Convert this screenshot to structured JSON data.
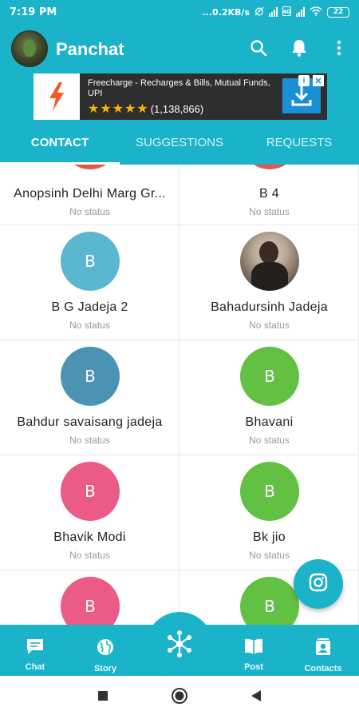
{
  "status_bar": {
    "time": "7:19 PM",
    "network_speed": "...0.2KB/s",
    "battery": "22"
  },
  "header": {
    "app_title": "Panchat",
    "icons": [
      "avatar",
      "search-icon",
      "bell-icon",
      "more-vert-icon"
    ]
  },
  "ad": {
    "title": "Freecharge - Recharges & Bills, Mutual Funds, UPI",
    "stars": "★★★★★",
    "rating_count": "(1,138,866)",
    "info_label": "i",
    "close_label": "✕"
  },
  "tabs": [
    {
      "label": "CONTACT",
      "active": true
    },
    {
      "label": "SUGGESTIONS",
      "active": false
    },
    {
      "label": "REQUESTS",
      "active": false
    }
  ],
  "contacts": [
    {
      "name": "Anopsinh Delhi Marg Gr...",
      "status": "No status",
      "initial": "",
      "color": "#e2574c"
    },
    {
      "name": "B  4",
      "status": "No status",
      "initial": "",
      "color": "#e2574c"
    },
    {
      "name": "B G Jadeja 2",
      "status": "No status",
      "initial": "B",
      "color": "#5ab7cf"
    },
    {
      "name": "Bahadursinh Jadeja",
      "status": "No status",
      "initial": "",
      "color": "photo"
    },
    {
      "name": "Bahdur savaisang jadeja",
      "status": "No status",
      "initial": "B",
      "color": "#4a93b3"
    },
    {
      "name": "Bhavani",
      "status": "No status",
      "initial": "B",
      "color": "#62c043"
    },
    {
      "name": "Bhavik Modi",
      "status": "No status",
      "initial": "B",
      "color": "#ec5a86"
    },
    {
      "name": "Bk jio",
      "status": "No status",
      "initial": "B",
      "color": "#62c043"
    },
    {
      "name": "",
      "status": "",
      "initial": "B",
      "color": "#ec5a86"
    },
    {
      "name": "",
      "status": "",
      "initial": "B",
      "color": "#62c043"
    }
  ],
  "bottom_nav": [
    {
      "label": "Chat",
      "icon": "chat-icon"
    },
    {
      "label": "Story",
      "icon": "globe-icon"
    },
    {
      "label": "",
      "icon": "network-icon"
    },
    {
      "label": "Post",
      "icon": "book-icon"
    },
    {
      "label": "Contacts",
      "icon": "contacts-icon"
    }
  ],
  "colors": {
    "primary": "#1ab3c9",
    "ad_background": "#2e2e2e",
    "star": "#f6b500"
  }
}
